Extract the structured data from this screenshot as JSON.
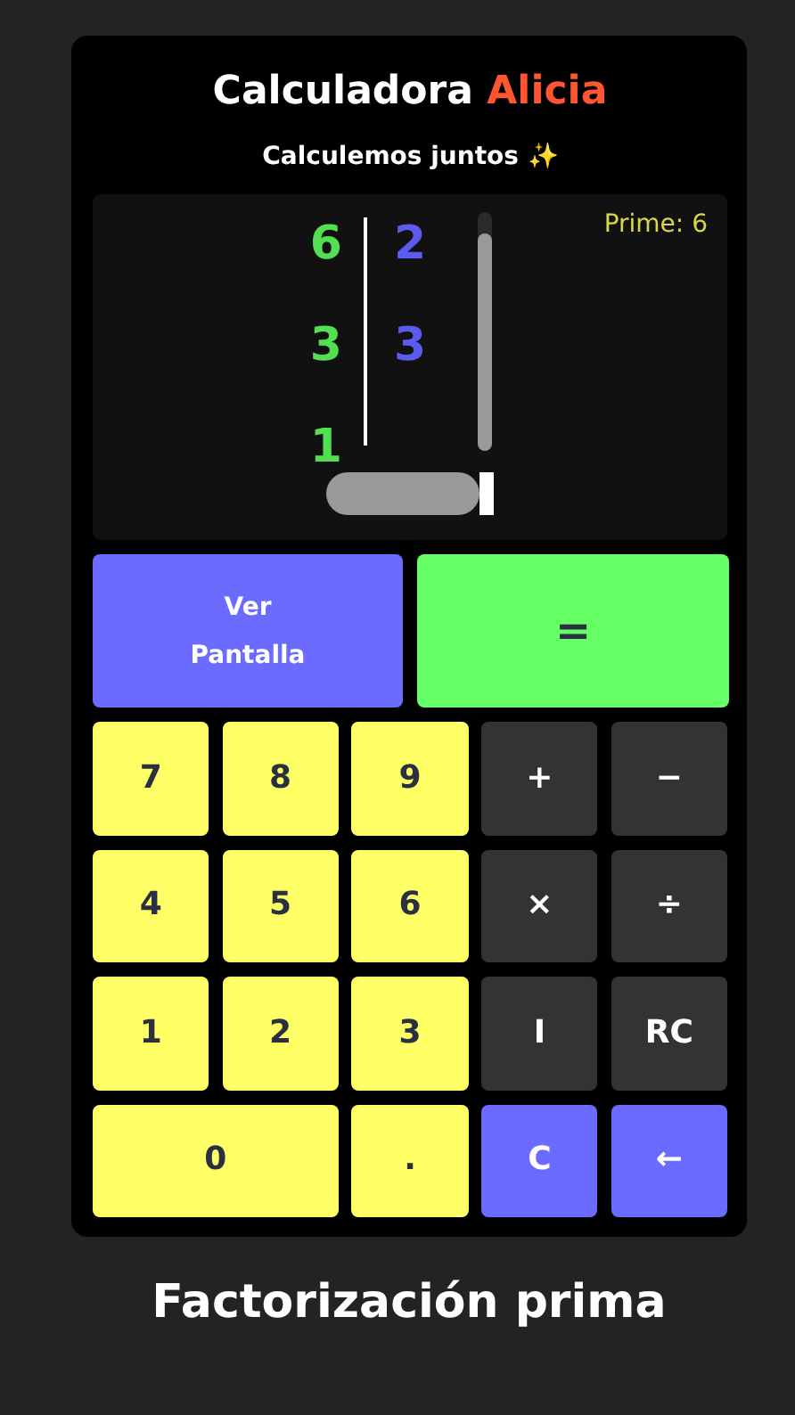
{
  "header": {
    "title": "Calculadora",
    "title_accent": "Alicia",
    "subtitle": "Calculemos juntos ✨"
  },
  "display": {
    "prime_label": "Prime: 6",
    "factor_rows": [
      {
        "dividend": "6",
        "divisor": "2"
      },
      {
        "dividend": "3",
        "divisor": "3"
      },
      {
        "dividend": "1"
      }
    ]
  },
  "top_buttons": [
    {
      "label": "Ver\nPantalla",
      "kind": "action"
    },
    {
      "label": "=",
      "kind": "equals"
    }
  ],
  "keys": [
    {
      "label": "7",
      "kind": "digit"
    },
    {
      "label": "8",
      "kind": "digit"
    },
    {
      "label": "9",
      "kind": "digit"
    },
    {
      "label": "+",
      "kind": "op"
    },
    {
      "label": "−",
      "kind": "op"
    },
    {
      "label": "4",
      "kind": "digit"
    },
    {
      "label": "5",
      "kind": "digit"
    },
    {
      "label": "6",
      "kind": "digit"
    },
    {
      "label": "×",
      "kind": "op"
    },
    {
      "label": "÷",
      "kind": "op"
    },
    {
      "label": "1",
      "kind": "digit"
    },
    {
      "label": "2",
      "kind": "digit"
    },
    {
      "label": "3",
      "kind": "digit"
    },
    {
      "label": "I",
      "kind": "op"
    },
    {
      "label": "RC",
      "kind": "op"
    },
    {
      "label": "0",
      "kind": "digit",
      "wide": true
    },
    {
      "label": ".",
      "kind": "digit"
    },
    {
      "label": "C",
      "kind": "action"
    },
    {
      "label": "←",
      "kind": "action"
    }
  ],
  "caption": "Factorización prima"
}
